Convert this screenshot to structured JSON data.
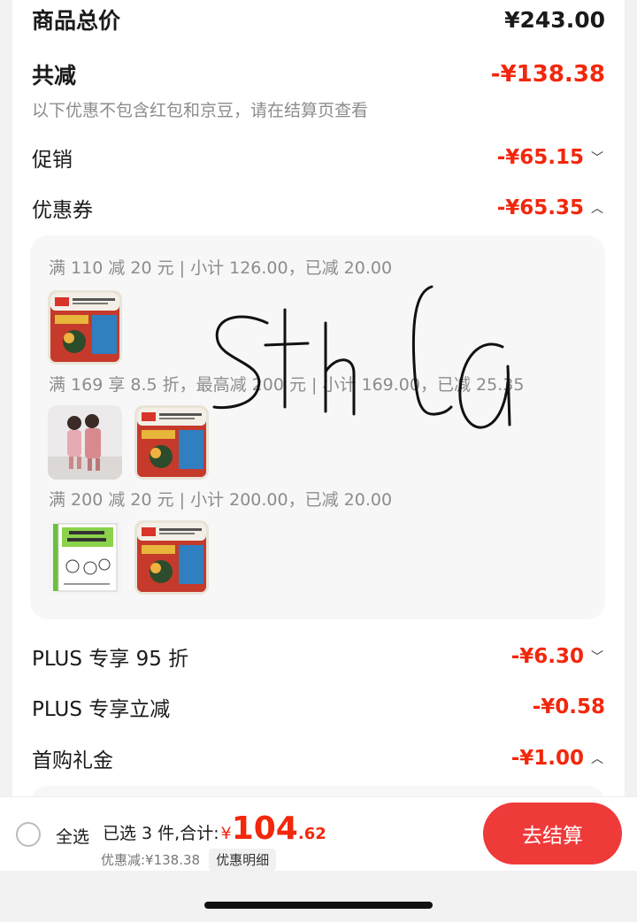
{
  "summary": {
    "goods_total_label": "商品总价",
    "goods_total_value": "¥243.00",
    "reduction_label": "共减",
    "reduction_value": "-¥138.38",
    "reduction_note": "以下优惠不包含红包和京豆，请在结算页查看"
  },
  "discounts": {
    "promo": {
      "label": "促销",
      "value": "-¥65.15",
      "chevron": "chevron-down-icon"
    },
    "coupon": {
      "label": "优惠券",
      "value": "-¥65.35",
      "chevron": "chevron-up-icon"
    },
    "plus95": {
      "label": "PLUS 专享 95 折",
      "value": "-¥6.30",
      "chevron": "chevron-down-icon"
    },
    "plus_instant": {
      "label": "PLUS 专享立减",
      "value": "-¥0.58"
    },
    "first_purchase": {
      "label": "首购礼金",
      "value": "-¥1.00",
      "chevron": "chevron-up-icon"
    }
  },
  "coupon_rules": [
    {
      "text": "满 110 减 20 元 | 小计 126.00，已减 20.00",
      "thumbs": [
        "snack-package-image"
      ]
    },
    {
      "text": "满 169 享 8.5 折，最高减 200 元 | 小计 169.00，已减 25.35",
      "thumbs": [
        "kids-clothing-image",
        "snack-package-image"
      ]
    },
    {
      "text": "满 200 减 20 元 | 小计 200.00，已减 20.00",
      "thumbs": [
        "comic-book-image",
        "snack-package-image"
      ]
    }
  ],
  "bottom_bar": {
    "select_all": "全选",
    "selected_prefix": "已选 3 件,合计:",
    "currency": "¥",
    "total_int": "104",
    "total_dec": ".62",
    "discount_text": "优惠减:¥138.38",
    "detail_label": "优惠明细",
    "checkout_label": "去结算"
  },
  "colors": {
    "accent": "#f2270c",
    "checkout_button": "#ef3a3a",
    "panel_bg": "#f7f7f7"
  }
}
